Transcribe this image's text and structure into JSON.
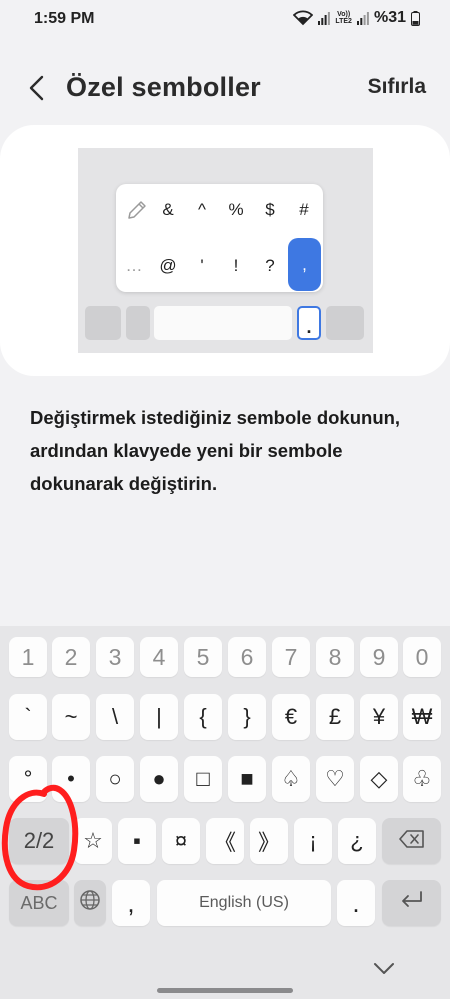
{
  "status_bar": {
    "time": "1:59 PM",
    "network_label_top": "Vo))",
    "network_label_bottom": "LTE2",
    "battery": "%31"
  },
  "header": {
    "title": "Özel semboller",
    "reset_label": "Sıfırla"
  },
  "preview": {
    "row1": [
      "&",
      "^",
      "%",
      "$",
      "#"
    ],
    "row2": [
      "…",
      "@",
      "'",
      "!",
      "?"
    ],
    "selected_symbol": ",",
    "dot_key": "."
  },
  "description": "Değiştirmek istediğiniz sembole dokunun, ardından klavyede yeni bir sembole dokunarak değiştirin.",
  "keyboard": {
    "numbers": [
      "1",
      "2",
      "3",
      "4",
      "5",
      "6",
      "7",
      "8",
      "9",
      "0"
    ],
    "row1": [
      "`",
      "~",
      "\\",
      "|",
      "{",
      "}",
      "€",
      "£",
      "¥",
      "₩"
    ],
    "row2": [
      "°",
      "•",
      "○",
      "●",
      "□",
      "■",
      "♤",
      "♡",
      "◇",
      "♧"
    ],
    "page_toggle": "2/2",
    "row3": [
      "☆",
      "▪",
      "¤",
      "《",
      "》",
      "¡",
      "¿"
    ],
    "abc_label": "ABC",
    "comma": ",",
    "space_label": "English (US)",
    "period": "."
  },
  "colors": {
    "accent": "#3e78e2",
    "annotation": "#ff1e1e"
  }
}
